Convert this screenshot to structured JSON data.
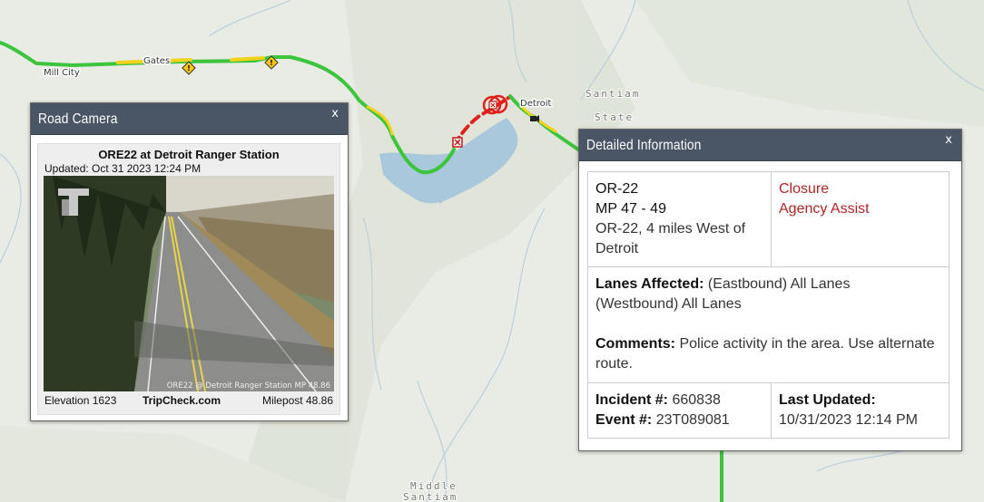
{
  "map": {
    "labels": {
      "mill_city": "Mill City",
      "gates": "Gates",
      "detroit": "Detroit",
      "santiam_state_1": "Santiam",
      "santiam_state_2": "State",
      "middle_santiam_1": "Middle",
      "middle_santiam_2": "Santiam"
    },
    "colors": {
      "road_green": "#3cc43c",
      "road_yellow": "#f2d21b",
      "closure_red": "#e0201c",
      "water": "#a9c8db",
      "background": "#e9ece4"
    },
    "icons": [
      "warning-icon",
      "warning-icon",
      "closure-icon",
      "closure-icon",
      "camera-icon",
      "flag-icon"
    ]
  },
  "camera_panel": {
    "title": "Road Camera",
    "close": "x",
    "camera_name": "ORE22 at Detroit Ranger Station",
    "updated": "Updated: Oct 31 2023  12:24 PM",
    "image_watermark": "ORE22 @ Detroit Ranger Station MP 48.86",
    "elevation": "Elevation  1623",
    "site": "TripCheck.com",
    "milepost": "Milepost 48.86"
  },
  "detail_panel": {
    "title": "Detailed Information",
    "close": "x",
    "route": "OR-22",
    "mileposts": "MP 47 - 49",
    "location": "OR-22, 4 miles West of Detroit",
    "event_type": "Closure",
    "event_subtype": "Agency Assist",
    "lanes_label": "Lanes Affected:",
    "lanes_eb": "(Eastbound) All Lanes",
    "lanes_wb": "(Westbound) All Lanes",
    "comments_label": "Comments:",
    "comments": "Police activity in the area. Use alternate route.",
    "incident_label": "Incident #:",
    "incident": "660838",
    "event_label": "Event #:",
    "event": "23T089081",
    "last_updated_label": "Last Updated:",
    "last_updated": "10/31/2023 12:14 PM"
  }
}
